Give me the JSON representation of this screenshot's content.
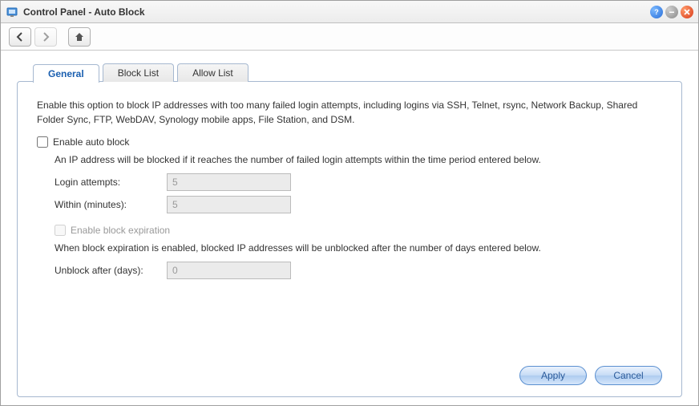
{
  "window": {
    "title": "Control Panel - Auto Block"
  },
  "tabs": {
    "general": "General",
    "blocklist": "Block List",
    "allowlist": "Allow List"
  },
  "content": {
    "description": "Enable this option to block IP addresses with too many failed login attempts, including logins via SSH, Telnet, rsync, Network Backup, Shared Folder Sync, FTP, WebDAV, Synology mobile apps, File Station, and DSM.",
    "enable_auto_block_label": "Enable auto block",
    "enable_auto_block_checked": false,
    "blocked_note": "An IP address will be blocked if it reaches the number of failed login attempts within the time period entered below.",
    "login_attempts_label": "Login attempts:",
    "login_attempts_value": "5",
    "within_label": "Within (minutes):",
    "within_value": "5",
    "enable_expiration_label": "Enable block expiration",
    "enable_expiration_checked": false,
    "expiration_note": "When block expiration is enabled, blocked IP addresses will be unblocked after the number of days entered below.",
    "unblock_label": "Unblock after (days):",
    "unblock_value": "0"
  },
  "buttons": {
    "apply": "Apply",
    "cancel": "Cancel"
  }
}
